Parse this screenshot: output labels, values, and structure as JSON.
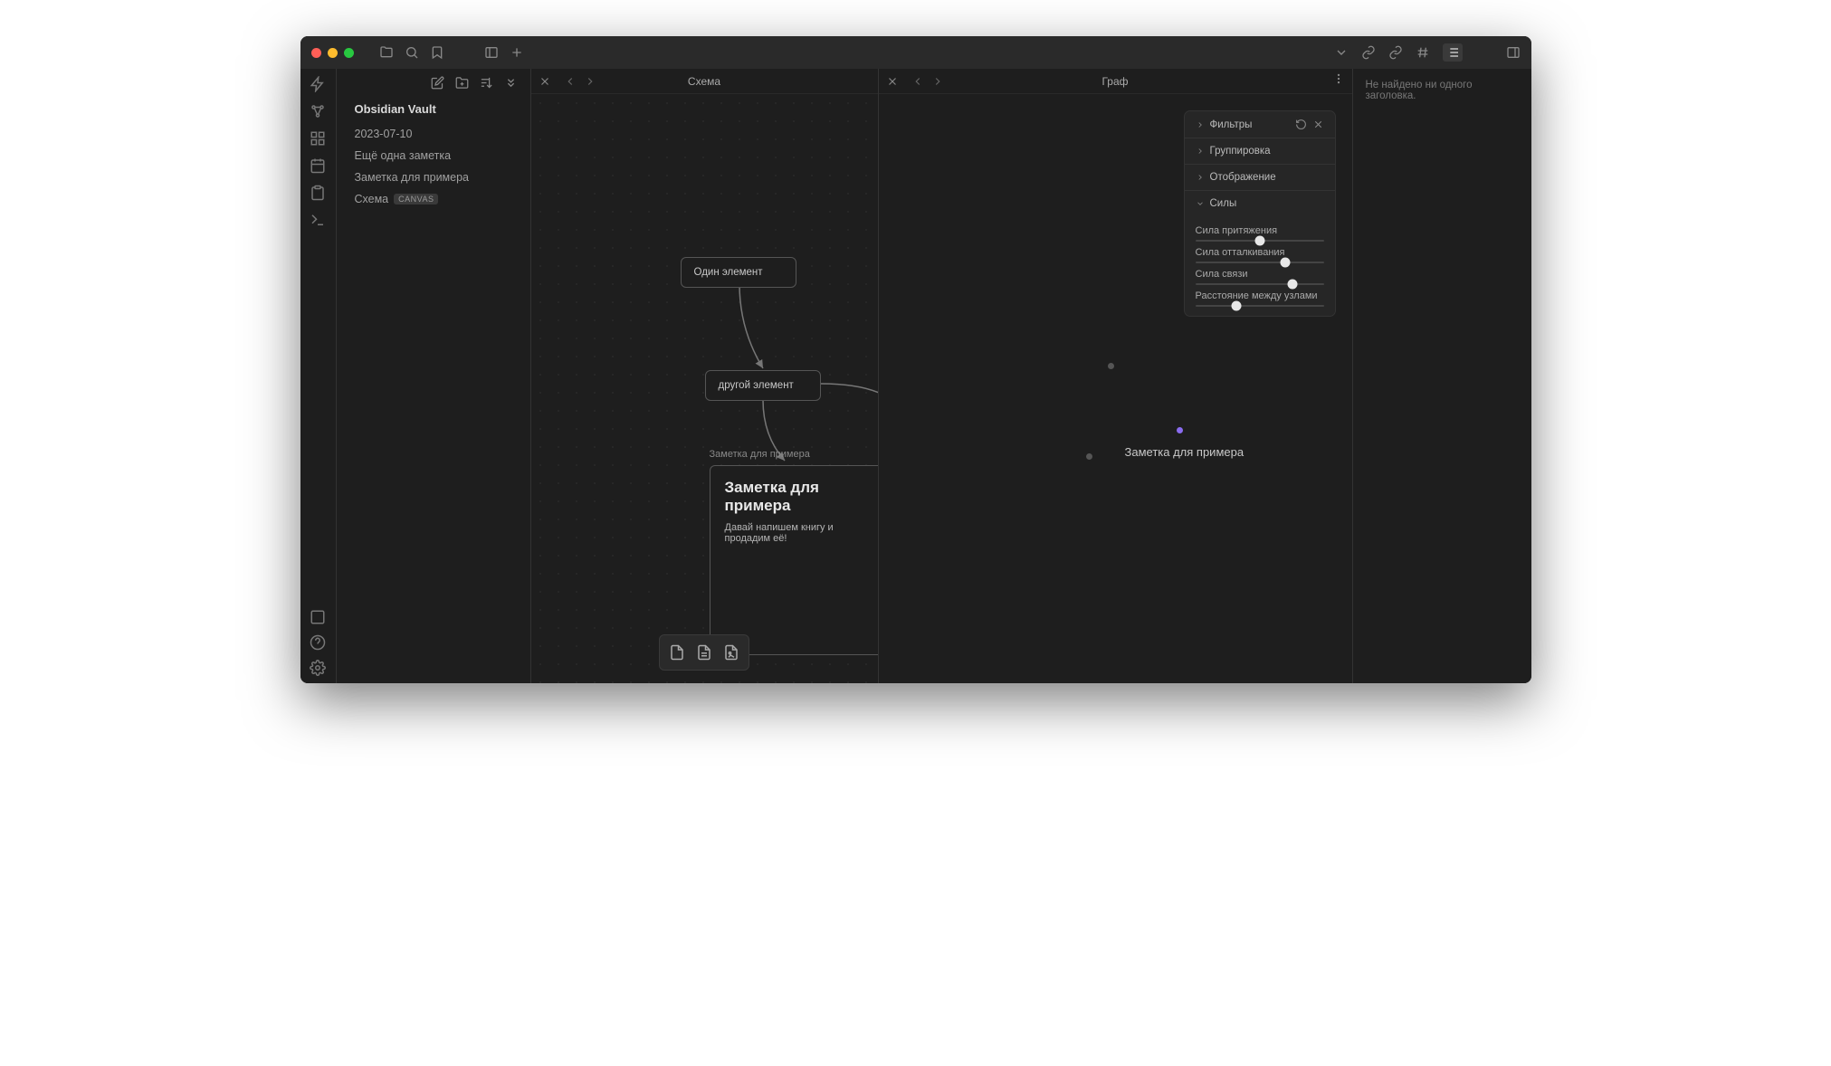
{
  "vault_title": "Obsidian Vault",
  "files": [
    {
      "name": "2023-07-10"
    },
    {
      "name": "Ещё одна заметка"
    },
    {
      "name": "Заметка для примера"
    },
    {
      "name": "Схема",
      "badge": "CANVAS"
    }
  ],
  "tabs": {
    "left": "Схема",
    "right": "Граф"
  },
  "vtabs": {
    "left": "Схема",
    "right": "Граф"
  },
  "canvas": {
    "node1": "Один элемент",
    "node2": "другой элемент",
    "card_label": "Заметка для примера",
    "card_title": "Заметка для примера",
    "card_body": "Давай напишем книгу и продадим её!"
  },
  "graph": {
    "main_label": "Заметка для примера"
  },
  "settings": {
    "filters": "Фильтры",
    "grouping": "Группировка",
    "display": "Отображение",
    "forces": "Силы",
    "slider1": "Сила притяжения",
    "slider2": "Сила отталкивания",
    "slider3": "Сила связи",
    "slider4": "Расстояние между узлами"
  },
  "outline_empty": "Не найдено ни одного заголовка."
}
